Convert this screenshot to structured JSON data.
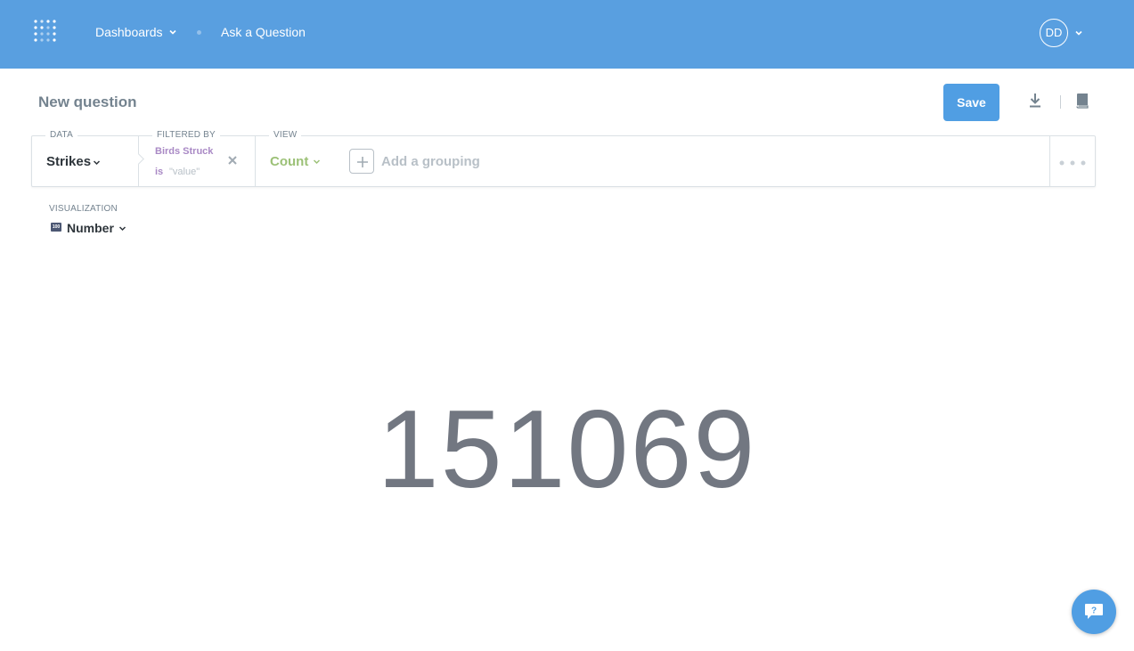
{
  "nav": {
    "logo_icon": "metabase-logo-icon",
    "dashboards_label": "Dashboards",
    "ask_label": "Ask a Question",
    "avatar_initials": "DD",
    "bg_color": "#599fe0"
  },
  "header": {
    "title": "New question",
    "save_label": "Save",
    "download_icon": "download-icon",
    "reference_icon": "book-icon"
  },
  "query": {
    "data_label": "DATA",
    "data_value": "Strikes",
    "filter_label": "FILTERED BY",
    "filter_field": "Birds Struck",
    "filter_operator": "is",
    "filter_value": "\"value\"",
    "view_label": "VIEW",
    "view_value": "Count",
    "grouping_placeholder": "Add a grouping",
    "filter_color": "#a989c5",
    "view_color": "#9cc177"
  },
  "visualization": {
    "label": "VISUALIZATION",
    "icon_text": "100",
    "value": "Number"
  },
  "result": {
    "scalar": "151069"
  },
  "help": {
    "icon": "help-chat-icon"
  }
}
